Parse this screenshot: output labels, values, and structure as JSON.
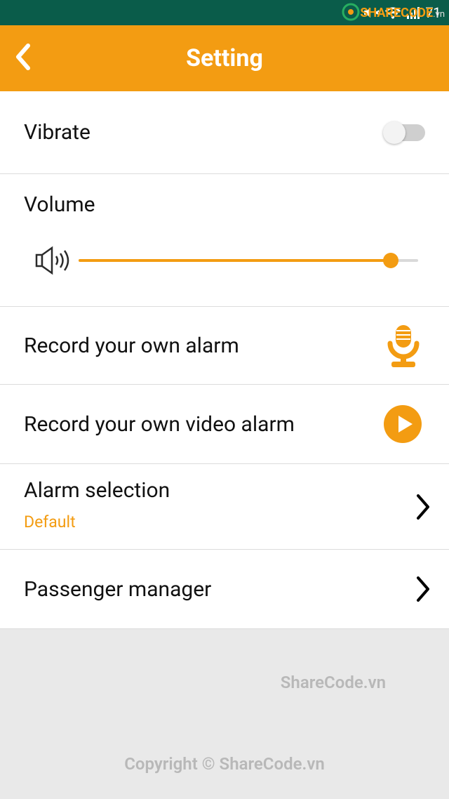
{
  "status": {
    "battery_text": "71"
  },
  "header": {
    "title": "Setting"
  },
  "settings": {
    "vibrate": {
      "label": "Vibrate",
      "enabled": false
    },
    "volume": {
      "label": "Volume",
      "value_pct": 92
    },
    "record_audio": {
      "label": "Record your own alarm"
    },
    "record_video": {
      "label": "Record your own video alarm"
    },
    "alarm_selection": {
      "label": "Alarm selection",
      "value": "Default"
    },
    "passenger": {
      "label": "Passenger manager"
    }
  },
  "watermarks": {
    "top_brand": "SHARECODE",
    "top_suffix": ".vn",
    "mid": "ShareCode.vn",
    "bottom": "Copyright © ShareCode.vn"
  },
  "colors": {
    "accent": "#f39c12",
    "statusbar": "#0a5c4a"
  }
}
